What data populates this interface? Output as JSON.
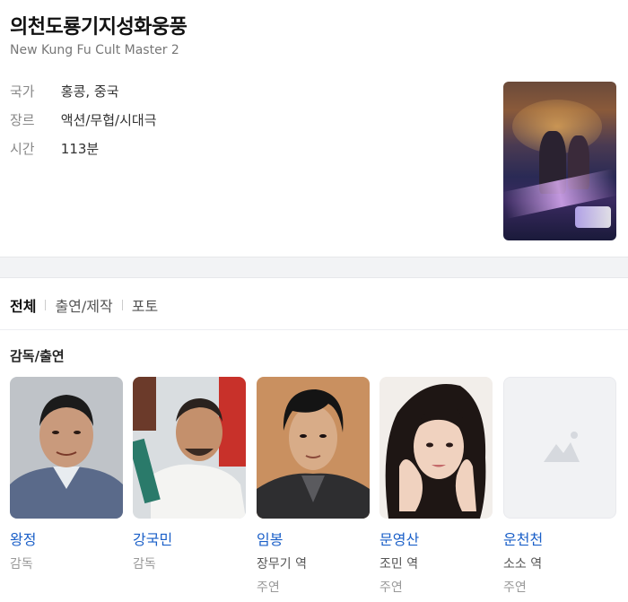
{
  "movie": {
    "title": "의천도룡기지성화웅풍",
    "subtitle": "New Kung Fu Cult Master 2",
    "info": [
      {
        "key": "국가",
        "value": "홍콩, 중국"
      },
      {
        "key": "장르",
        "value": "액션/무협/시대극"
      },
      {
        "key": "시간",
        "value": "113분"
      }
    ]
  },
  "tabs": [
    "전체",
    "출연/제작",
    "포토"
  ],
  "section_title": "감독/출연",
  "cast": [
    {
      "name": "왕정",
      "role": "감독",
      "type": ""
    },
    {
      "name": "강국민",
      "role": "감독",
      "type": ""
    },
    {
      "name": "임봉",
      "role": "장무기 역",
      "type": "주연"
    },
    {
      "name": "문영산",
      "role": "조민 역",
      "type": "주연"
    },
    {
      "name": "운천천",
      "role": "소소 역",
      "type": "주연"
    }
  ],
  "colors": {
    "link": "#1a5fc8",
    "muted": "#888888"
  }
}
